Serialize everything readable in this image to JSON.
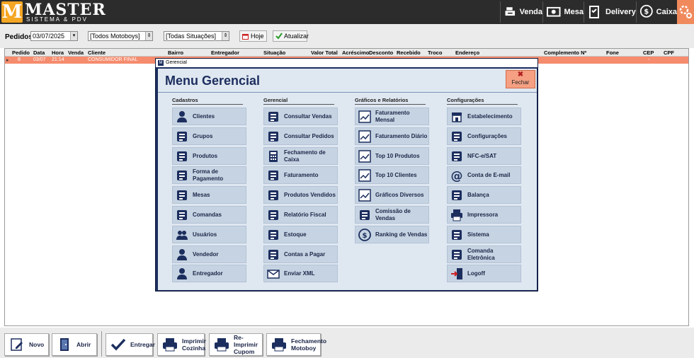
{
  "app": {
    "logo_letter": "M",
    "logo_name": "MASTER",
    "logo_subtitle": "SISTEMA & PDV"
  },
  "topnav": {
    "venda": "Venda",
    "mesa": "Mesa",
    "delivery": "Delivery",
    "caixa": "Caixa"
  },
  "filters": {
    "pedidos_label": "Pedidos",
    "date": "03/07/2025",
    "motoboys": "[Todos Motoboys]",
    "situacoes": "[Todas Situações]",
    "hoje": "Hoje",
    "atualizar": "Atualizar"
  },
  "grid": {
    "columns": [
      "Pedido",
      "Data",
      "Hora",
      "Venda",
      "Cliente",
      "Bairro",
      "Entregador",
      "Situação",
      "Valor Total",
      "Acréscimo",
      "Desconto",
      "Recebido",
      "Troco",
      "Endereço",
      "Complemento Nº",
      "Fone",
      "CEP",
      "CPF"
    ],
    "row": {
      "pedido": "8",
      "data": "03/07",
      "hora": "21:14",
      "cliente": "CONSUMIDOR FINAL",
      "cep": "-"
    }
  },
  "dialog": {
    "title": "Gerencial",
    "heading": "Menu Gerencial",
    "close_label": "Fechar",
    "columns": [
      {
        "header": "Cadastros",
        "items": [
          {
            "label": "Clientes",
            "icon": "user-icon"
          },
          {
            "label": "Grupos",
            "icon": "clipboard-list-icon"
          },
          {
            "label": "Produtos",
            "icon": "wine-bottle-icon"
          },
          {
            "label": "Forma de Pagamento",
            "icon": "card-cash-icon"
          },
          {
            "label": "Mesas",
            "icon": "table-dining-icon"
          },
          {
            "label": "Comandas",
            "icon": "checklist-icon"
          },
          {
            "label": "Usuários",
            "icon": "users-icon"
          },
          {
            "label": "Vendedor",
            "icon": "seller-icon"
          },
          {
            "label": "Entregador",
            "icon": "delivery-person-icon"
          }
        ]
      },
      {
        "header": "Gerencial",
        "items": [
          {
            "label": "Consultar Vendas",
            "icon": "document-list-icon"
          },
          {
            "label": "Consultar Pedidos",
            "icon": "document-edit-icon"
          },
          {
            "label": "Fechamento de Caixa",
            "icon": "calculator-icon"
          },
          {
            "label": "Faturamento",
            "icon": "money-bill-icon"
          },
          {
            "label": "Produtos Vendidos",
            "icon": "drinks-icon"
          },
          {
            "label": "Relatório Fiscal",
            "icon": "fiscal-report-icon"
          },
          {
            "label": "Estoque",
            "icon": "forklift-icon"
          },
          {
            "label": "Contas a Pagar",
            "icon": "cards-icon"
          },
          {
            "label": "Enviar XML",
            "icon": "envelope-icon"
          }
        ]
      },
      {
        "header": "Gráficos e Relatórios",
        "items": [
          {
            "label": "Faturamento Mensal",
            "icon": "chart-line-icon"
          },
          {
            "label": "Faturamento Diário",
            "icon": "chart-line-icon"
          },
          {
            "label": "Top 10 Produtos",
            "icon": "chart-line-icon"
          },
          {
            "label": "Top 10 Clientes",
            "icon": "chart-line-icon"
          },
          {
            "label": "Gráficos Diversos",
            "icon": "chart-line-icon"
          },
          {
            "label": "Comissão de Vendas",
            "icon": "commission-icon"
          },
          {
            "label": "Ranking de Vendas",
            "icon": "dollar-circle-icon"
          }
        ]
      },
      {
        "header": "Configurações",
        "items": [
          {
            "label": "Estabelecimento",
            "icon": "store-icon"
          },
          {
            "label": "Configurações",
            "icon": "settings-machine-icon"
          },
          {
            "label": "NFC-e/SAT",
            "icon": "receipt-icon"
          },
          {
            "label": "Conta de E-mail",
            "icon": "at-sign-icon"
          },
          {
            "label": "Balança",
            "icon": "scale-icon"
          },
          {
            "label": "Impressora",
            "icon": "printer-icon"
          },
          {
            "label": "Sistema",
            "icon": "system-icon"
          },
          {
            "label": "Comanda Eletrônica",
            "icon": "phone-icon"
          },
          {
            "label": "Logoff",
            "icon": "logoff-icon"
          }
        ]
      }
    ]
  },
  "bottombar": {
    "novo": "Novo",
    "abrir": "Abrir",
    "entregar": "Entregar",
    "imprimir_cozinha": "Imprimir Cozinha",
    "reimprimir_cupom": "Re-Imprimir Cupom",
    "fechamento_motoboy": "Fechamento Motoboy"
  },
  "colors": {
    "topbar": "#2c2c2c",
    "accent_orange": "#f58c6e",
    "dialog_navy": "#1c2e5e",
    "menu_tile": "#c6d3e2"
  }
}
